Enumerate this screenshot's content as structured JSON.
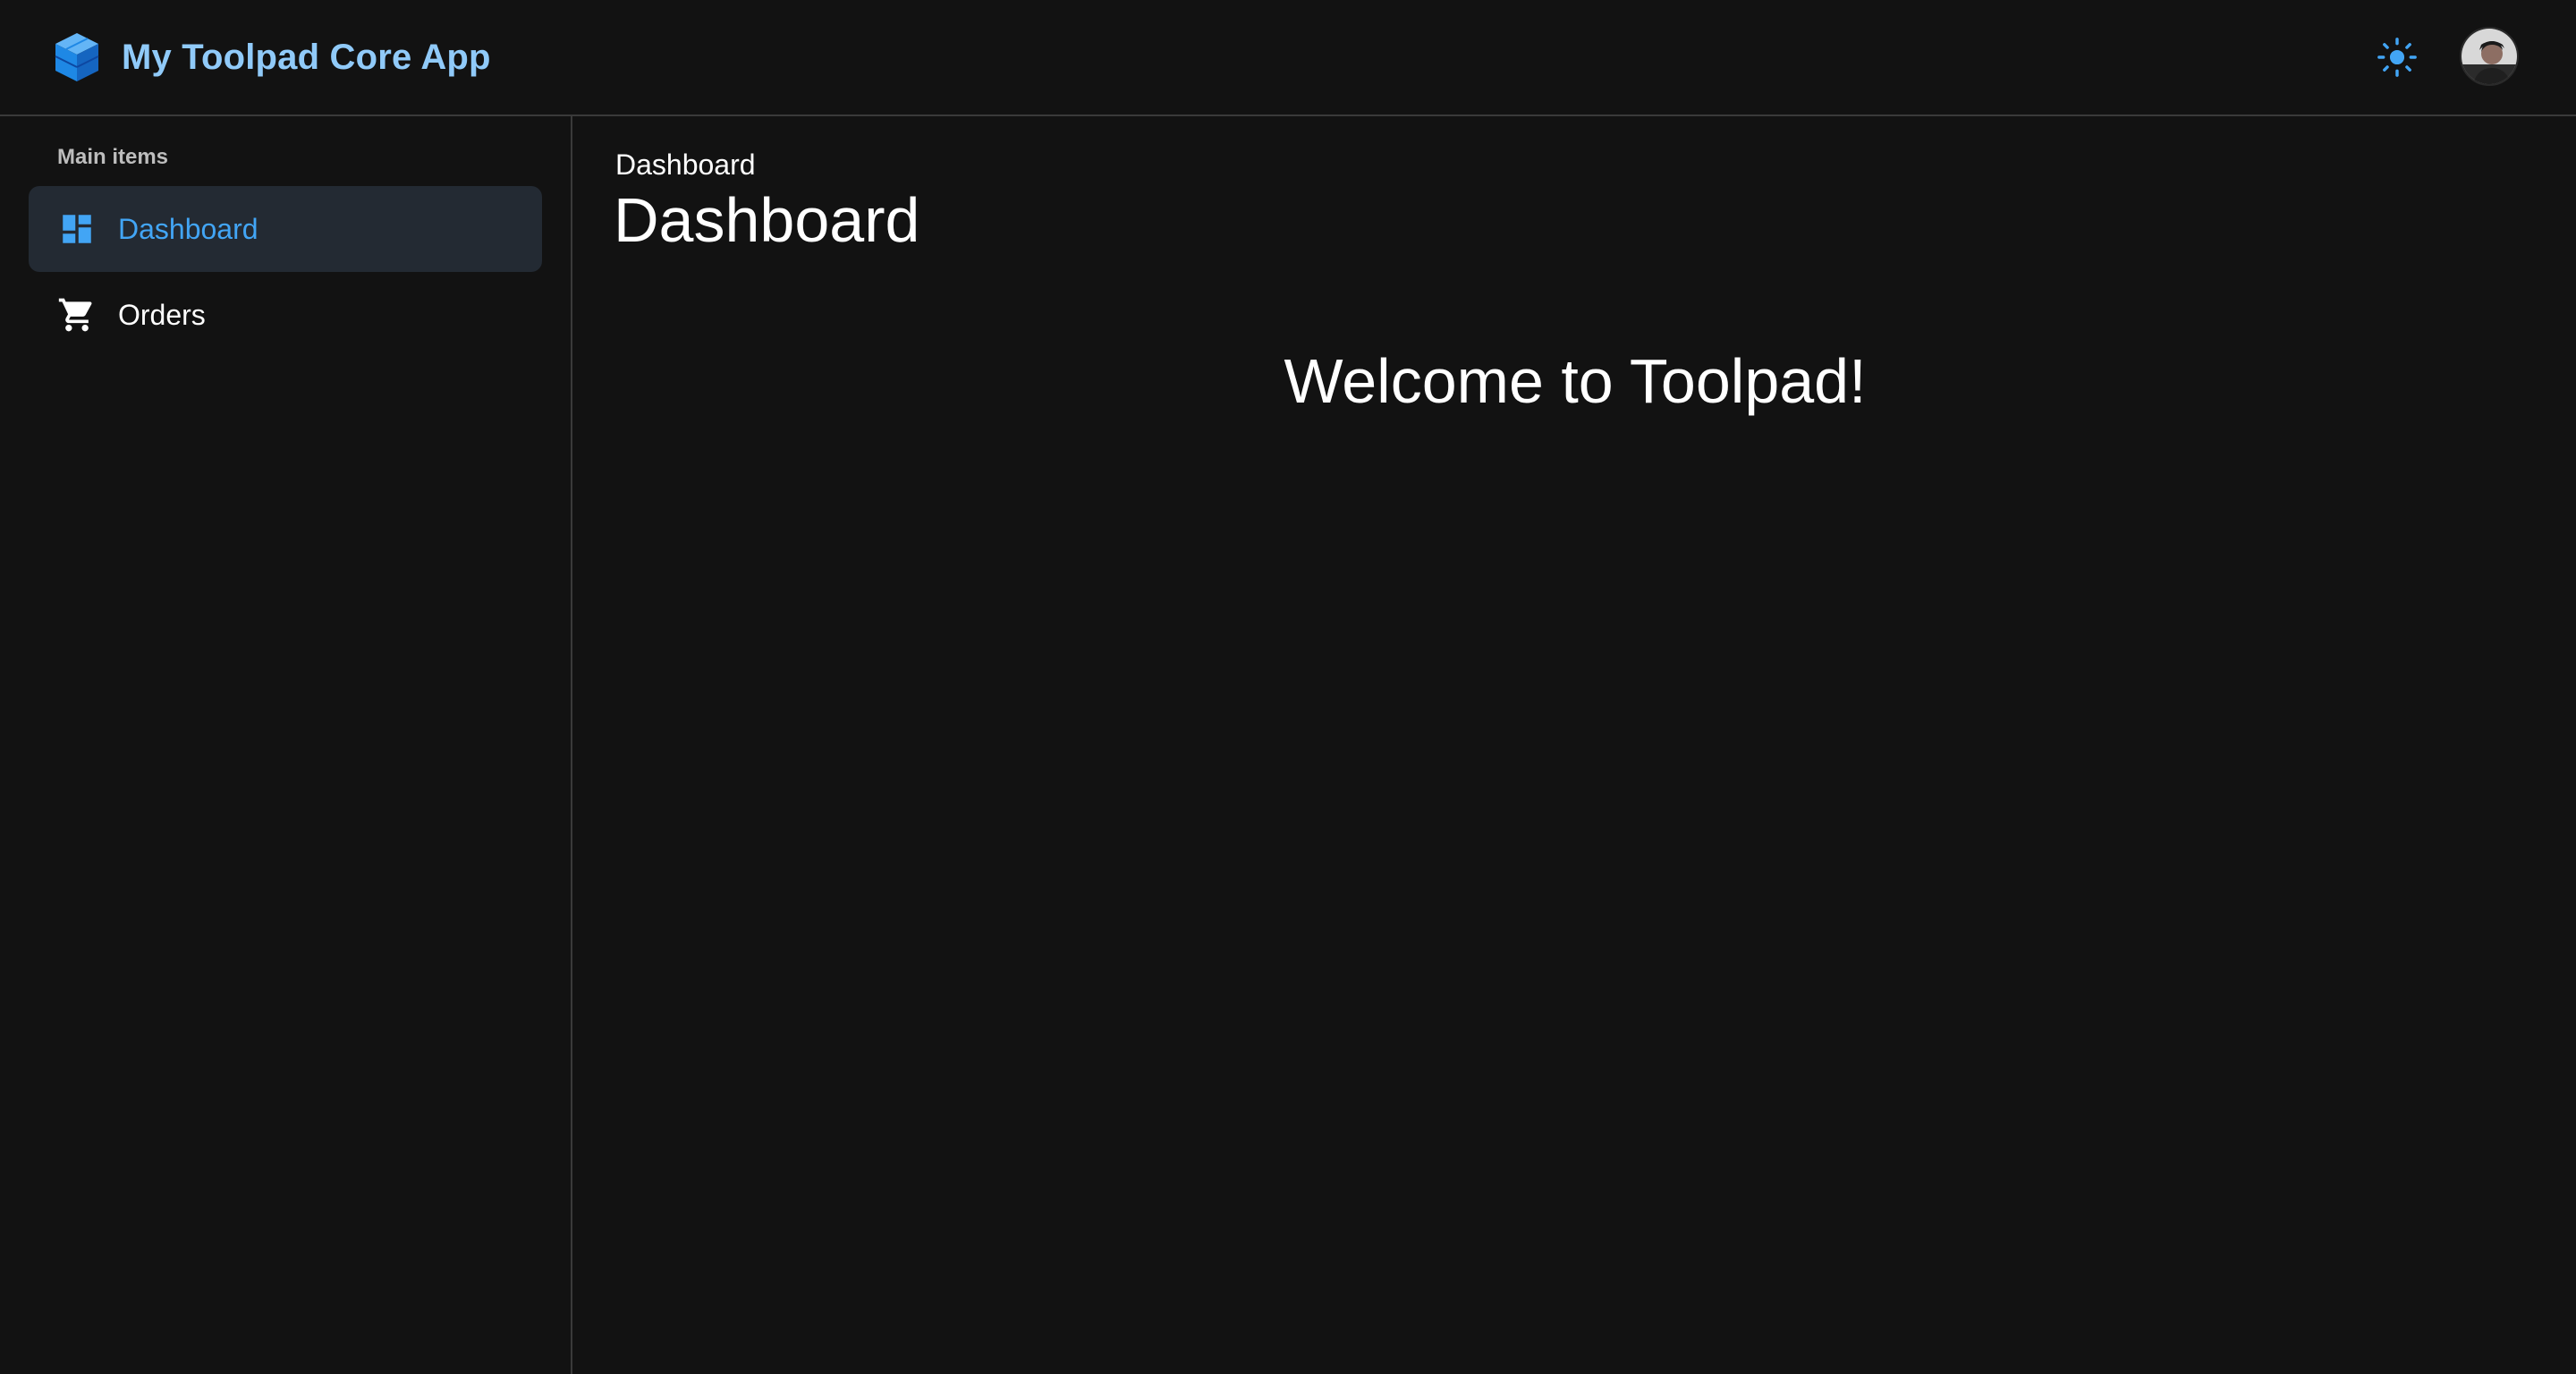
{
  "app": {
    "title": "My Toolpad Core App",
    "logo_icon": "cube-stack-logo-icon",
    "accent_color": "#42a5f5",
    "title_color": "#90caf9"
  },
  "header": {
    "theme_toggle_icon": "sun-icon",
    "avatar_icon": "user-avatar"
  },
  "sidebar": {
    "section_label": "Main items",
    "items": [
      {
        "label": "Dashboard",
        "icon": "dashboard-icon",
        "active": true
      },
      {
        "label": "Orders",
        "icon": "shopping-cart-icon",
        "active": false
      }
    ]
  },
  "main": {
    "breadcrumb": "Dashboard",
    "page_title": "Dashboard",
    "welcome_text": "Welcome to Toolpad!"
  }
}
